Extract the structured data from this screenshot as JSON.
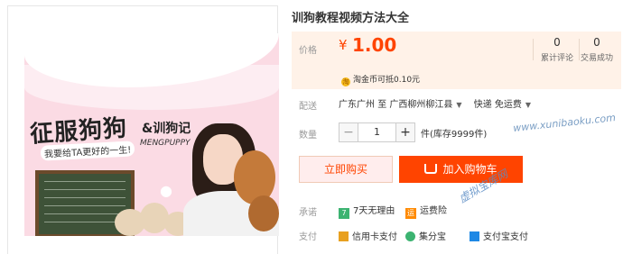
{
  "product": {
    "title": "训狗教程视频方法大全",
    "image": {
      "title_main": "征服狗狗",
      "title_side": "&训狗记",
      "subtitle": "我要给TA更好的一生!",
      "brand": "MENGPUPPY"
    }
  },
  "price": {
    "label": "价格",
    "currency": "¥",
    "value": "1.00",
    "stats": [
      {
        "count": "0",
        "label": "累计评论"
      },
      {
        "count": "0",
        "label": "交易成功"
      }
    ],
    "coin_text": "淘金币可抵0.10元",
    "coin_symbol": "淘"
  },
  "shipping": {
    "label": "配送",
    "from": "广东广州",
    "to_word": "至",
    "to": "广西柳州柳江县",
    "method": "快递 免运费"
  },
  "quantity": {
    "label": "数量",
    "minus": "−",
    "value": "1",
    "plus": "+",
    "stock": "件(库存9999件)"
  },
  "actions": {
    "buy_label": "立即购买",
    "cart_label": "加入购物车"
  },
  "promise": {
    "label": "承诺",
    "items": [
      {
        "icon_text": "7",
        "label": "7天无理由",
        "color": "#3cb371"
      },
      {
        "icon_text": "运",
        "label": "运费险",
        "color": "#ff8a00"
      }
    ]
  },
  "payment": {
    "label": "支付",
    "items": [
      "信用卡支付",
      "集分宝",
      "支付宝支付"
    ]
  },
  "watermarks": {
    "site": "www.xunibaoku.com",
    "brand": "虚拟宝库网"
  },
  "colors": {
    "accent": "#ff4400",
    "price_bg": "#fff2e8"
  }
}
